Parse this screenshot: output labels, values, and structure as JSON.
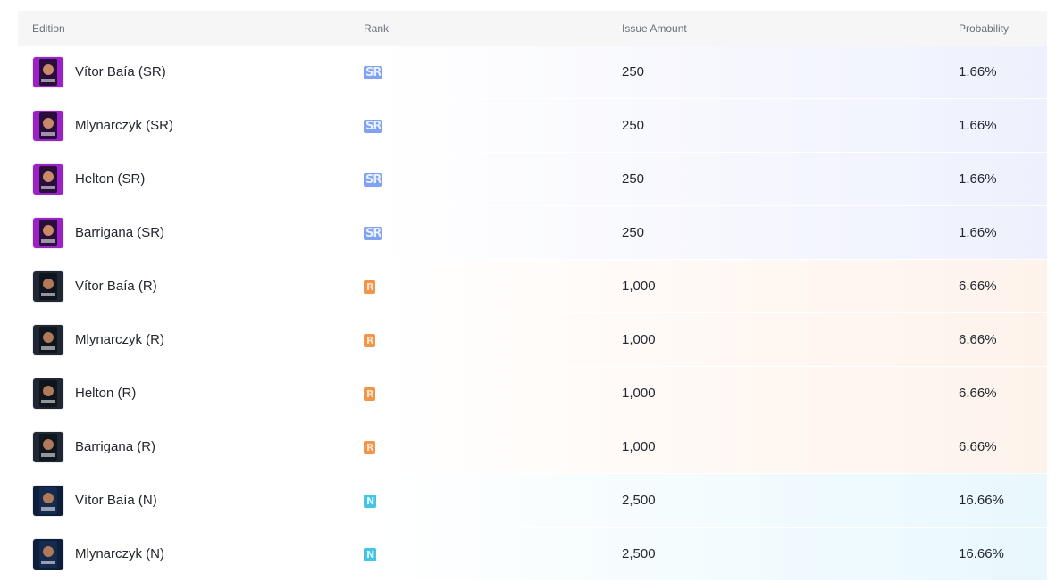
{
  "header": {
    "edition": "Edition",
    "rank": "Rank",
    "issue_amount": "Issue Amount",
    "probability": "Probability"
  },
  "rows": [
    {
      "edition": "Vítor Baía (SR)",
      "rank": "SR",
      "issue": "250",
      "prob": "1.66%"
    },
    {
      "edition": "Mlynarczyk (SR)",
      "rank": "SR",
      "issue": "250",
      "prob": "1.66%"
    },
    {
      "edition": "Helton (SR)",
      "rank": "SR",
      "issue": "250",
      "prob": "1.66%"
    },
    {
      "edition": "Barrigana (SR)",
      "rank": "SR",
      "issue": "250",
      "prob": "1.66%"
    },
    {
      "edition": "Vítor Baía (R)",
      "rank": "R",
      "issue": "1,000",
      "prob": "6.66%"
    },
    {
      "edition": "Mlynarczyk (R)",
      "rank": "R",
      "issue": "1,000",
      "prob": "6.66%"
    },
    {
      "edition": "Helton (R)",
      "rank": "R",
      "issue": "1,000",
      "prob": "6.66%"
    },
    {
      "edition": "Barrigana (R)",
      "rank": "R",
      "issue": "1,000",
      "prob": "6.66%"
    },
    {
      "edition": "Vítor Baía (N)",
      "rank": "N",
      "issue": "2,500",
      "prob": "16.66%"
    },
    {
      "edition": "Mlynarczyk (N)",
      "rank": "N",
      "issue": "2,500",
      "prob": "16.66%"
    }
  ],
  "rank_colors": {
    "SR": "#7fa3f2",
    "R": "#f0954a",
    "N": "#43c5e3"
  },
  "thumb_colors": {
    "SR": {
      "bg": "#9b22c9",
      "frame": "#2a0d3a",
      "face": "#c98a6a"
    },
    "R": {
      "bg": "#1e2733",
      "frame": "#0f151d",
      "face": "#b07a5a"
    },
    "N": {
      "bg": "#0d1e3a",
      "frame": "#142a4e",
      "face": "#b07a5a"
    }
  }
}
